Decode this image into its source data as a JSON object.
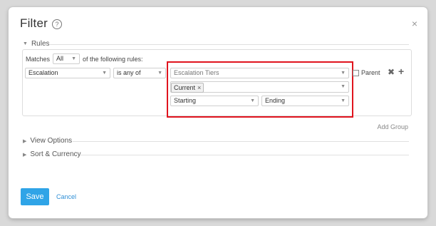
{
  "dialog": {
    "title": "Filter",
    "help_icon": "?",
    "close_icon": "×"
  },
  "sections": {
    "rules": "Rules",
    "view_options": "View Options",
    "sort_currency": "Sort & Currency"
  },
  "rules": {
    "matches_label": "Matches",
    "matches_value": "All",
    "matches_suffix": "of the following rules:",
    "field_value": "Escalation",
    "operator_value": "is any of",
    "escalation_tiers_placeholder": "Escalation Tiers",
    "tag_label": "Current",
    "tag_remove": "×",
    "starting_value": "Starting",
    "ending_value": "Ending",
    "parent_label": "Parent",
    "remove_rule_icon": "✖",
    "add_rule_icon": "+"
  },
  "add_group_label": "Add Group",
  "footer": {
    "save_label": "Save",
    "cancel_label": "Cancel"
  },
  "colors": {
    "accent": "#2fa4e7",
    "highlight": "#e0141e"
  }
}
